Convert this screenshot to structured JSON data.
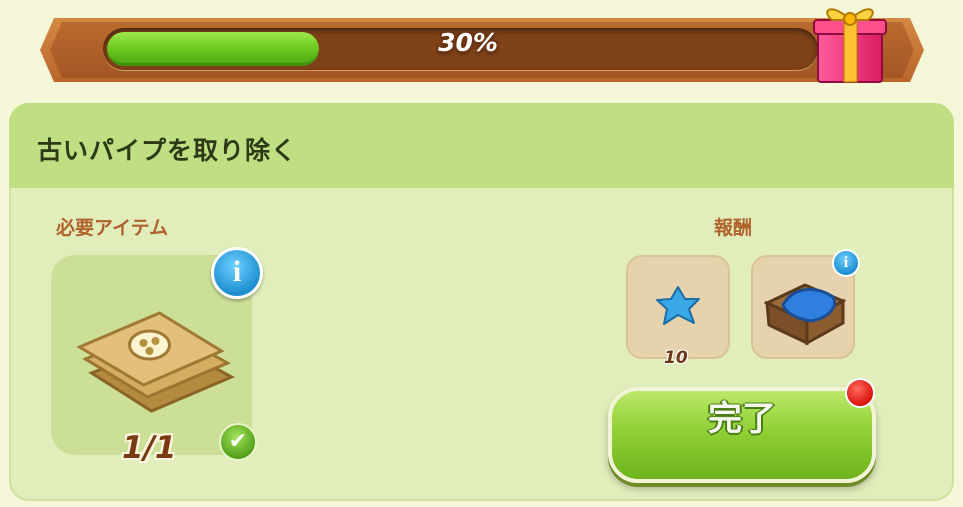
{
  "progress": {
    "percent": 30,
    "label": "30%",
    "fill_color": "#67c51b"
  },
  "header_reward_icon": "gift-box-icon",
  "task": {
    "title": "古いパイプを取り除く"
  },
  "required": {
    "label": "必要アイテム",
    "item_icon": "old-pipe-blanket-icon",
    "count": "1/1",
    "completed": true,
    "info_icon": "info-icon"
  },
  "rewards": {
    "label": "報酬",
    "items": [
      {
        "icon": "blue-star-icon",
        "quantity": "10"
      },
      {
        "icon": "crate-with-blue-cloth-icon",
        "quantity": ""
      }
    ]
  },
  "actions": {
    "complete_label": "完了",
    "has_notification": true
  },
  "colors": {
    "accent_green": "#8fd034",
    "panel_bg": "#e1eebc",
    "header_bg": "#bfdf82",
    "banner_brown": "#b8652a",
    "label_brown": "#b0632c"
  }
}
